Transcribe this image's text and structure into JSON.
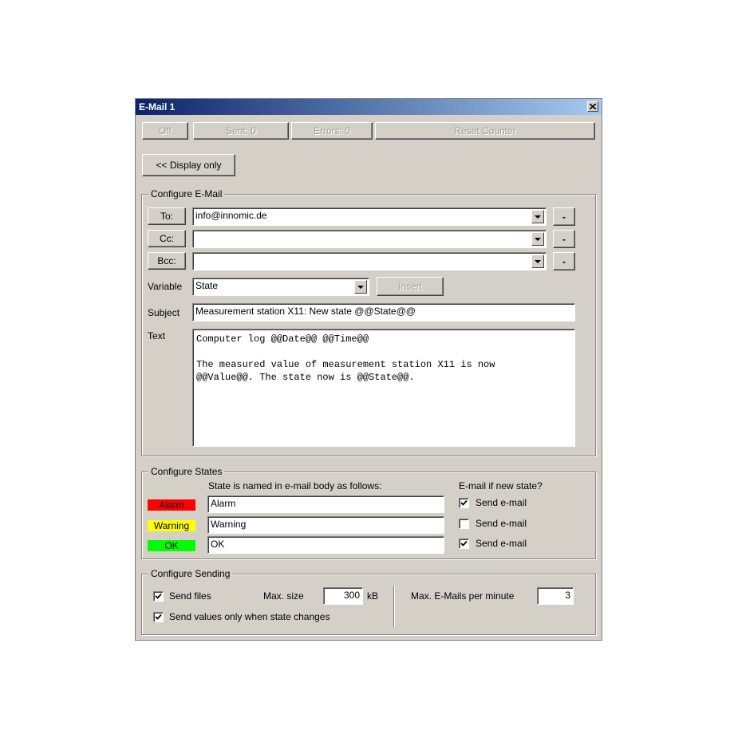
{
  "window": {
    "title": "E-Mail 1"
  },
  "status_bar": {
    "off": "Off",
    "sent": "Sent: 0",
    "errors": "Errors: 0",
    "reset": "Reset Counter"
  },
  "display_only": "<< Display only",
  "configure_email": {
    "legend": "Configure E-Mail",
    "to_label": "To:",
    "to_value": "info@innomic.de",
    "cc_label": "Cc:",
    "cc_value": "",
    "bcc_label": "Bcc:",
    "bcc_value": "",
    "remove_label": "-",
    "variable_label": "Variable",
    "variable_value": "State",
    "insert_label": "Insert",
    "subject_label": "Subject",
    "subject_value": "Measurement station X11: New state @@State@@",
    "text_label": "Text",
    "text_value": "Computer log @@Date@@ @@Time@@\n\nThe measured value of measurement station X11 is now\n@@Value@@. The state now is @@State@@."
  },
  "configure_states": {
    "legend": "Configure States",
    "header_name": "State is named in e-mail body as follows:",
    "header_send": "E-mail if new state?",
    "send_label": "Send e-mail",
    "states": [
      {
        "label": "Alarm",
        "color": "#ff0000",
        "value": "Alarm",
        "send": true
      },
      {
        "label": "Warning",
        "color": "#ffff00",
        "value": "Warning",
        "send": false
      },
      {
        "label": "OK",
        "color": "#00ff00",
        "value": "OK",
        "send": true
      }
    ]
  },
  "configure_sending": {
    "legend": "Configure Sending",
    "send_files_label": "Send files",
    "send_files": true,
    "max_size_label": "Max. size",
    "max_size_value": "300",
    "max_size_unit": "kB",
    "send_values_label": "Send values only when state changes",
    "send_values": true,
    "max_emails_label": "Max. E-Mails per minute",
    "max_emails_value": "3"
  },
  "icons": {
    "close": "close-icon",
    "dropdown": "chevron-down-icon",
    "check": "check-icon"
  }
}
